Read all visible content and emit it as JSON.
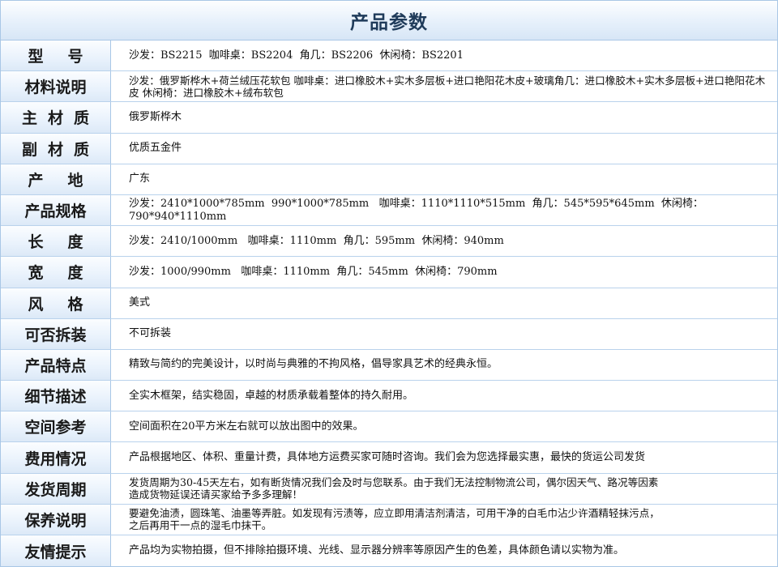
{
  "title": "产品参数",
  "rows": [
    {
      "label": "型号",
      "value": "沙发：BS2215  咖啡桌：BS2204  角几：BS2206  休闲椅：BS2201"
    },
    {
      "label": "材料说明",
      "value": "沙发：俄罗斯桦木+荷兰绒压花软包 咖啡桌：进口橡胶木+实木多层板+进口艳阳花木皮+玻璃角几：进口橡胶木+实木多层板+进口艳阳花木皮 休闲椅：进口橡胶木+绒布软包"
    },
    {
      "label": "主材质",
      "value": "俄罗斯桦木"
    },
    {
      "label": "副材质",
      "value": "优质五金件"
    },
    {
      "label": "产地",
      "value": "广东"
    },
    {
      "label": "产品规格",
      "value": "沙发：2410*1000*785mm  990*1000*785mm   咖啡桌：1110*1110*515mm  角几：545*595*645mm  休闲椅：790*940*1110mm"
    },
    {
      "label": "长度",
      "value": "沙发：2410/1000mm   咖啡桌：1110mm  角几：595mm  休闲椅：940mm"
    },
    {
      "label": "宽度",
      "value": "沙发：1000/990mm   咖啡桌：1110mm  角几：545mm  休闲椅：790mm"
    },
    {
      "label": "风格",
      "value": "美式"
    },
    {
      "label": "可否拆装",
      "value": "不可拆装"
    },
    {
      "label": "产品特点",
      "value": "精致与简约的完美设计，以时尚与典雅的不拘风格，倡导家具艺术的经典永恒。"
    },
    {
      "label": "细节描述",
      "value": "全实木框架，结实稳固，卓越的材质承载着整体的持久耐用。"
    },
    {
      "label": "空间参考",
      "value": "空间面积在20平方米左右就可以放出图中的效果。"
    },
    {
      "label": "费用情况",
      "value": "产品根据地区、体积、重量计费，具体地方运费买家可随时咨询。我们会为您选择最实惠，最快的货运公司发货"
    },
    {
      "label": "发货周期",
      "value": "发货周期为30-45天左右，如有断货情况我们会及时与您联系。由于我们无法控制物流公司，偶尔因天气、路况等因素\n造成货物延误还请买家给予多多理解！"
    },
    {
      "label": "保养说明",
      "value": "要避免油渍，圆珠笔、油墨等弄脏。如发现有污渍等，应立即用清洁剂清洁，可用干净的白毛巾沾少许酒精轻抹污点，\n之后再用干一点的湿毛巾抹干。"
    },
    {
      "label": "友情提示",
      "value": "产品均为实物拍摄，但不排除拍摄环境、光线、显示器分辨率等原因产生的色差，具体颜色请以实物为准。"
    }
  ]
}
